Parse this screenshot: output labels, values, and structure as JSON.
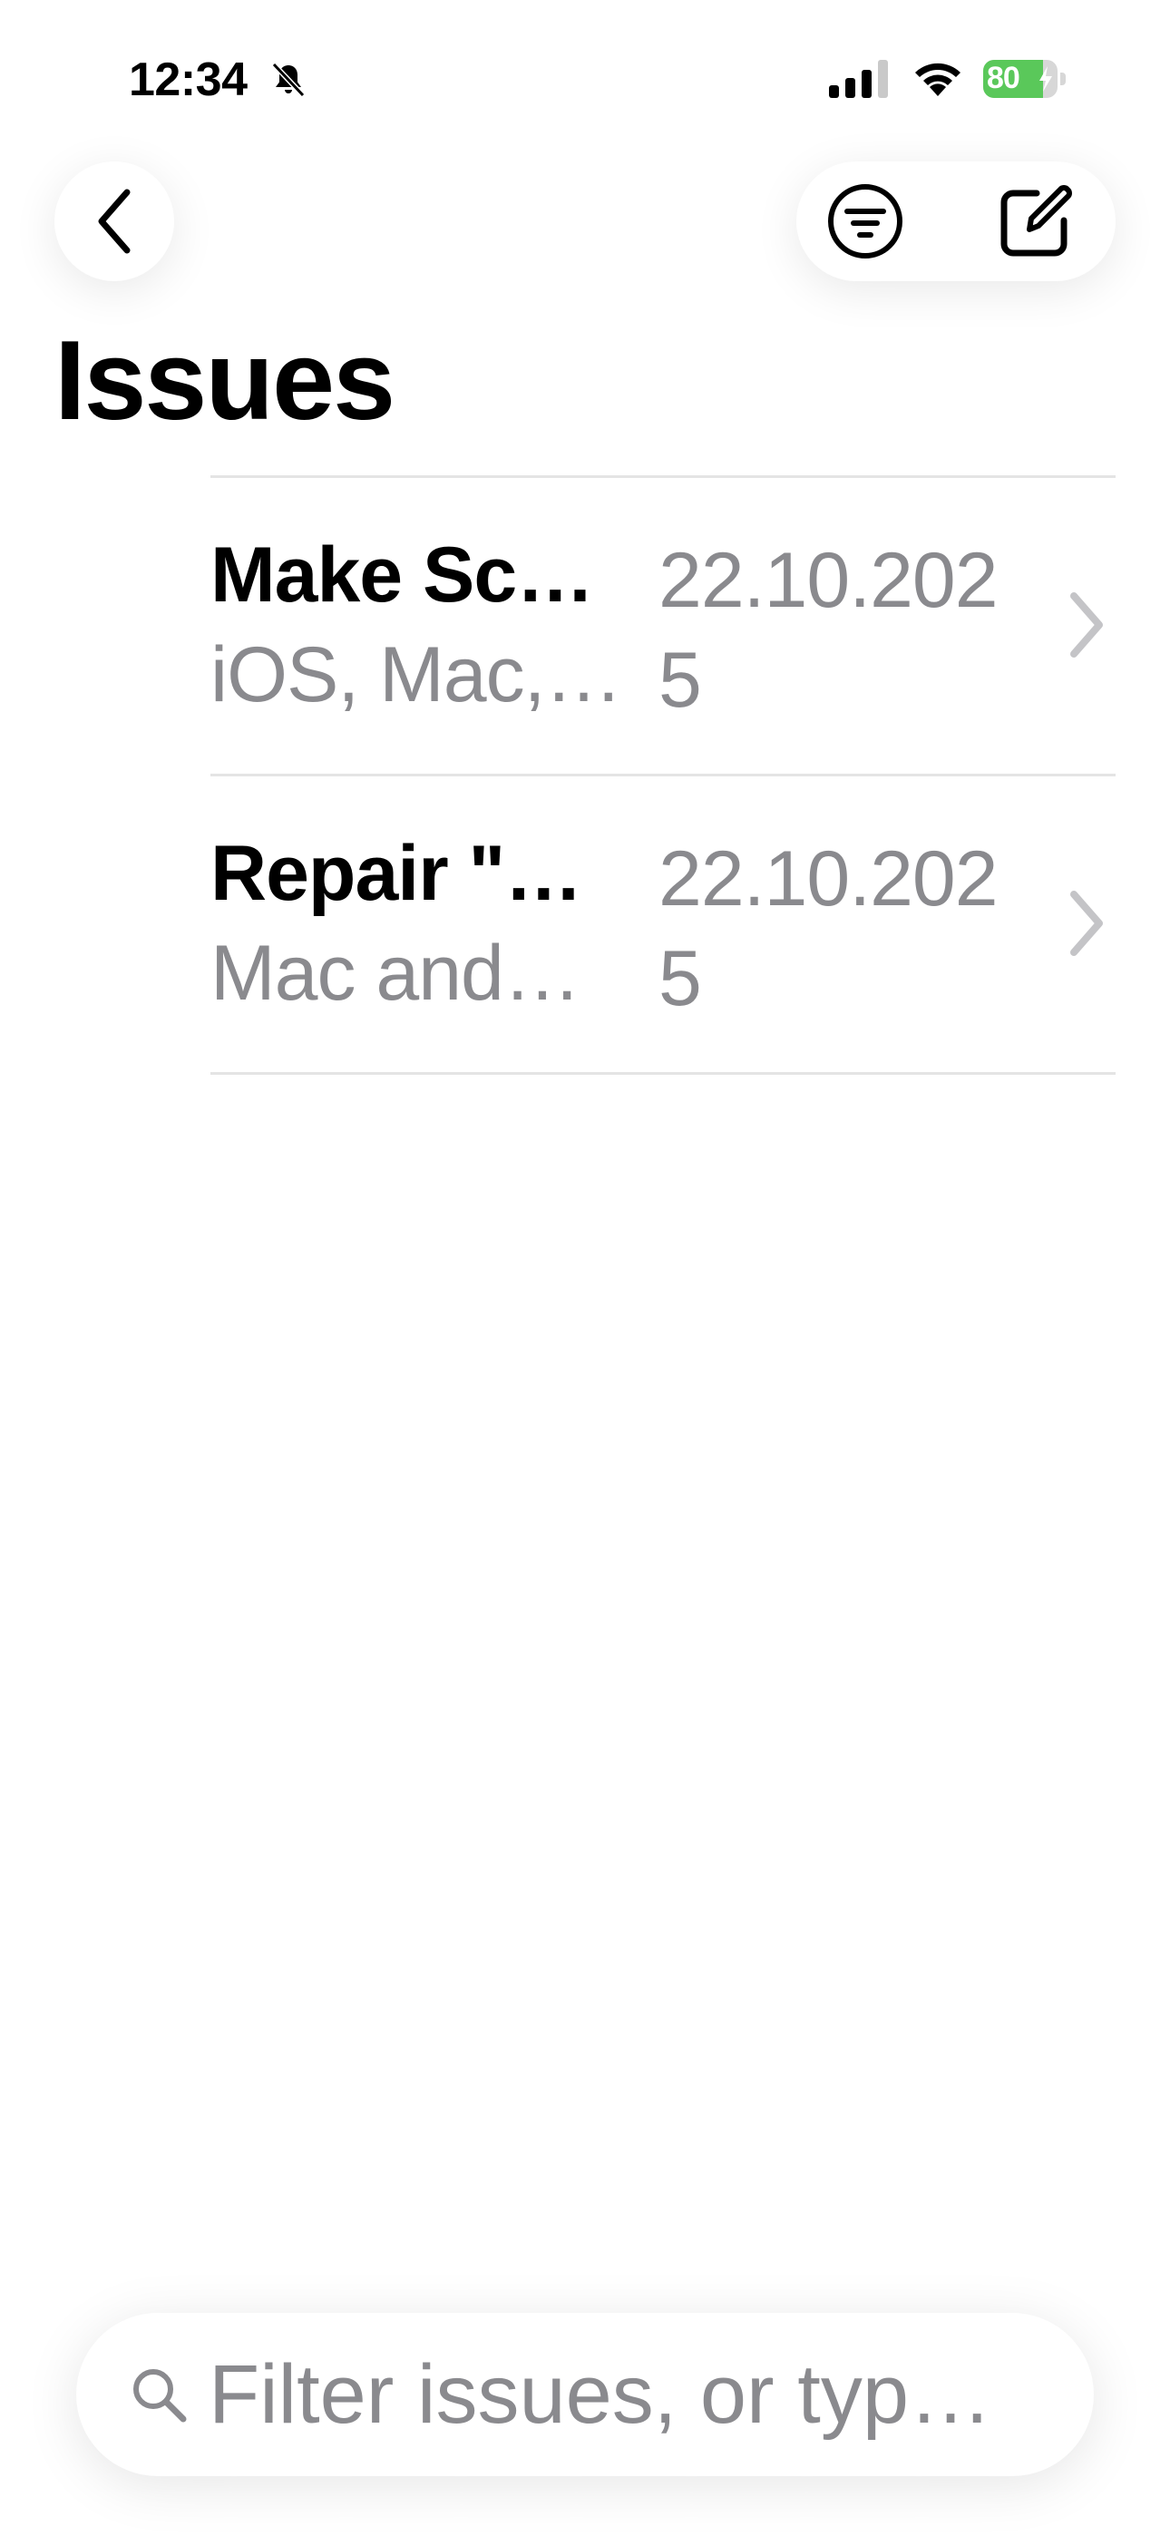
{
  "status_bar": {
    "time": "12:34",
    "battery_percent": "80",
    "battery_level": 0.8,
    "battery_color": "#5ac85a",
    "icons": [
      "bell-slash-icon",
      "cellular-signal-icon",
      "wifi-icon",
      "battery-charging-icon"
    ]
  },
  "nav": {
    "back_icon": "chevron-left-icon",
    "filter_icon": "filter-circle-icon",
    "compose_icon": "compose-icon"
  },
  "page": {
    "title": "Issues"
  },
  "issues": [
    {
      "title": "Make Sc…",
      "subtitle": "iOS, Mac,…",
      "date": "22.10.2025"
    },
    {
      "title": "Repair \"…",
      "subtitle": "Mac and…",
      "date": "22.10.2025"
    }
  ],
  "search": {
    "placeholder": "Filter issues, or type…",
    "value": ""
  },
  "colors": {
    "secondary_text": "#8a8a8e",
    "separator": "#e4e4e4",
    "chevron": "#c4c4c7"
  }
}
